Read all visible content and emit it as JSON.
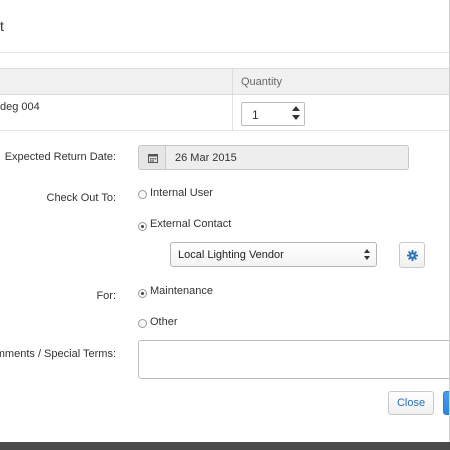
{
  "dialog": {
    "title_fragment": "t"
  },
  "table": {
    "headers": {
      "quantity": "Quantity"
    },
    "rows": [
      {
        "item": "deg 004",
        "quantity": "1"
      }
    ]
  },
  "form": {
    "expected_return_label": "Expected Return Date:",
    "expected_return_value": "26 Mar 2015",
    "check_out_to_label": "Check Out To:",
    "check_out_to_options": [
      {
        "label": "Internal User",
        "checked": false
      },
      {
        "label": "External Contact",
        "checked": true
      }
    ],
    "contact_select_value": "Local Lighting Vendor",
    "for_label": "For:",
    "for_options": [
      {
        "label": "Maintenance",
        "checked": true
      },
      {
        "label": "Other",
        "checked": false
      }
    ],
    "comments_label": "omments / Special Terms:",
    "comments_value": ""
  },
  "footer": {
    "close_label": "Close"
  },
  "icons": {
    "calendar": "calendar-icon",
    "gear": "gear-icon"
  },
  "colors": {
    "accent": "#2d84dc",
    "link": "#2a6fb4"
  }
}
